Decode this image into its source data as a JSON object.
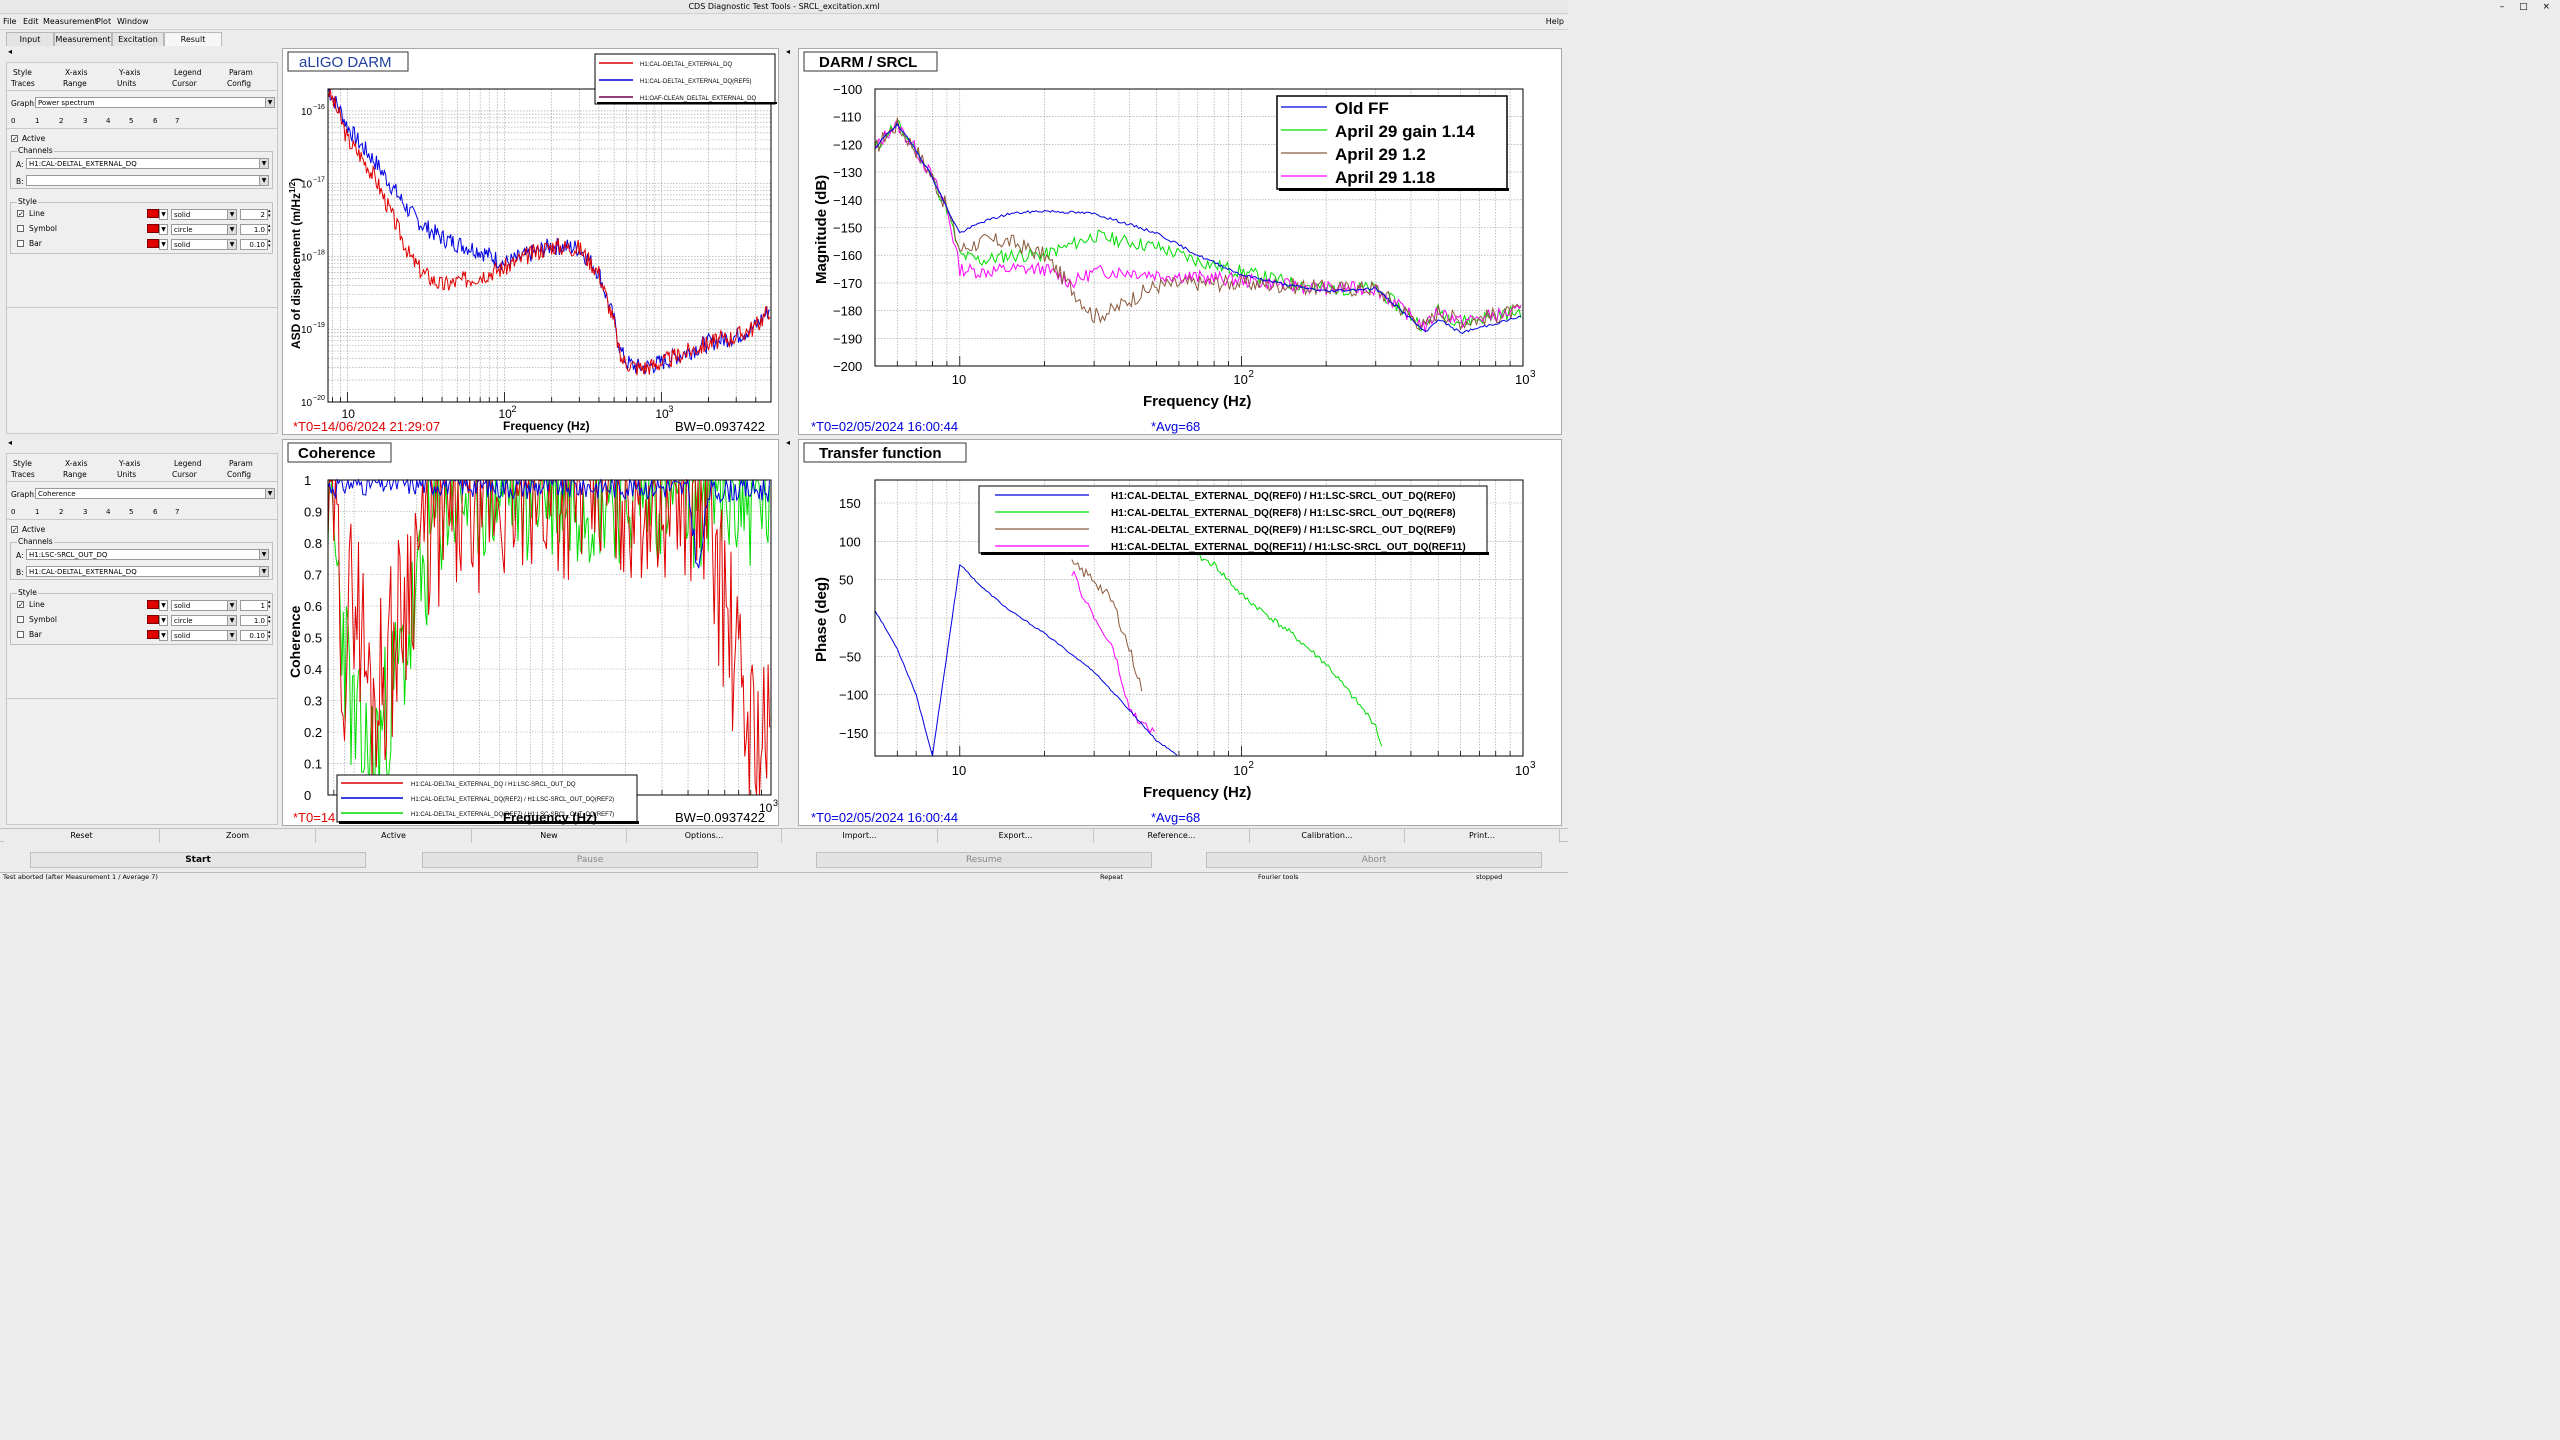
{
  "window": {
    "title": "CDS Diagnostic Test Tools - SRCL_excitation.xml",
    "controls": "– □ ×"
  },
  "menu": {
    "items": [
      "File",
      "Edit",
      "Measurement",
      "Plot",
      "Window"
    ],
    "help": "Help"
  },
  "tabs": [
    "Input",
    "Measurement",
    "Excitation",
    "Result"
  ],
  "collapse_glyph": "◂",
  "options_top": {
    "tabs_row1": [
      "Style",
      "X-axis",
      "Y-axis",
      "Legend",
      "Param"
    ],
    "tabs_row2": [
      "Traces",
      "Range",
      "Units",
      "Cursor",
      "Config"
    ],
    "graph_label": "Graph:",
    "graph_value": "Power spectrum",
    "trace_numbers": [
      "0",
      "1",
      "2",
      "3",
      "4",
      "5",
      "6",
      "7"
    ],
    "active_label": "Active",
    "channels_label": "Channels",
    "chan_a_label": "A:",
    "chan_a": "H1:CAL-DELTAL_EXTERNAL_DQ",
    "chan_b_label": "B:",
    "chan_b": "",
    "style_label": "Style",
    "line_label": "Line",
    "symbol_label": "Symbol",
    "bar_label": "Bar",
    "line_style": "solid",
    "symbol_style": "circle",
    "bar_style": "solid",
    "line_width": "2",
    "symbol_size": "1.0",
    "bar_width": "0.10"
  },
  "options_bottom": {
    "tabs_row1": [
      "Style",
      "X-axis",
      "Y-axis",
      "Legend",
      "Param"
    ],
    "tabs_row2": [
      "Traces",
      "Range",
      "Units",
      "Cursor",
      "Config"
    ],
    "graph_label": "Graph:",
    "graph_value": "Coherence",
    "trace_numbers": [
      "0",
      "1",
      "2",
      "3",
      "4",
      "5",
      "6",
      "7"
    ],
    "active_label": "Active",
    "channels_label": "Channels",
    "chan_a_label": "A:",
    "chan_a": "H1:LSC-SRCL_OUT_DQ",
    "chan_b_label": "B:",
    "chan_b": "H1:CAL-DELTAL_EXTERNAL_DQ",
    "style_label": "Style",
    "line_label": "Line",
    "symbol_label": "Symbol",
    "bar_label": "Bar",
    "line_style": "solid",
    "symbol_style": "circle",
    "bar_style": "solid",
    "line_width": "1",
    "symbol_size": "1.0",
    "bar_width": "0.10"
  },
  "plots": {
    "darm": {
      "title": "aLIGO DARM",
      "t0": "*T0=14/06/2024 21:29:07",
      "bw": "BW=0.0937422",
      "xlabel": "Frequency (Hz)",
      "ylabel": "ASD of displacement (m/Hz",
      "ylabel_sup": "1/2",
      "ylabel_end": ")",
      "legend": [
        "H1:CAL-DELTAL_EXTERNAL_DQ",
        "H1:CAL-DELTAL_EXTERNAL_DQ(REF5)",
        "H1:OAF-CLEAN_DELTAL_EXTERNAL_DQ"
      ],
      "xtick_labels": [
        "10",
        "10",
        "10"
      ],
      "xtick_exps": [
        "",
        "2",
        "3"
      ],
      "ytick_base": "10",
      "ytick_exps": [
        "−16",
        "−17",
        "−18",
        "−19",
        "−20"
      ]
    },
    "srcl": {
      "title": "DARM / SRCL",
      "t0": "*T0=02/05/2024 16:00:44",
      "avg": "*Avg=68",
      "xlabel": "Frequency (Hz)",
      "ylabel": "Magnitude (dB)",
      "legend": [
        "Old FF",
        "April 29 gain 1.14",
        "April 29 1.2",
        "April 29 1.18"
      ],
      "ytick_labels": [
        "−100",
        "−110",
        "−120",
        "−130",
        "−140",
        "−150",
        "−160",
        "−170",
        "−180",
        "−190",
        "−200"
      ],
      "xtick_labels": [
        "10",
        "10",
        "10"
      ],
      "xtick_exps": [
        "",
        "2",
        "3"
      ]
    },
    "coh": {
      "title": "Coherence",
      "t0": "*T0=14",
      "bw": "BW=0.0937422",
      "xlabel": "Frequency (Hz)",
      "ylabel": "Coherence",
      "x_end_label": "10",
      "x_end_exp": "3",
      "legend": [
        "H1:CAL-DELTAL_EXTERNAL_DQ / H1:LSC-SRCL_OUT_DQ",
        "H1:CAL-DELTAL_EXTERNAL_DQ(REF2) / H1:LSC-SRCL_OUT_DQ(REF2)",
        "H1:CAL-DELTAL_EXTERNAL_DQ(REF7) / H1:LSC-SRCL_OUT_DQ(REF7)"
      ],
      "ytick_labels": [
        "1",
        "0.9",
        "0.8",
        "0.7",
        "0.6",
        "0.5",
        "0.4",
        "0.3",
        "0.2",
        "0.1",
        "0"
      ]
    },
    "tf": {
      "title": "Transfer function",
      "t0": "*T0=02/05/2024 16:00:44",
      "avg": "*Avg=68",
      "xlabel": "Frequency (Hz)",
      "ylabel": "Phase (deg)",
      "legend": [
        "H1:CAL-DELTAL_EXTERNAL_DQ(REF0) / H1:LSC-SRCL_OUT_DQ(REF0)",
        "H1:CAL-DELTAL_EXTERNAL_DQ(REF8) / H1:LSC-SRCL_OUT_DQ(REF8)",
        "H1:CAL-DELTAL_EXTERNAL_DQ(REF9) / H1:LSC-SRCL_OUT_DQ(REF9)",
        "H1:CAL-DELTAL_EXTERNAL_DQ(REF11) / H1:LSC-SRCL_OUT_DQ(REF11)"
      ],
      "ytick_labels": [
        "150",
        "100",
        "50",
        "0",
        "−50",
        "−100",
        "−150"
      ],
      "xtick_labels": [
        "10",
        "10",
        "10"
      ],
      "xtick_exps": [
        "",
        "2",
        "3"
      ]
    }
  },
  "colors": {
    "red": "#e00000",
    "blue": "#0000e0",
    "purple": "#700050",
    "green": "#00dd00",
    "brown": "#8b5a3c",
    "magenta": "#ff00ff",
    "title_blue": "#2040a0"
  },
  "buttons_row": [
    "Reset",
    "Zoom",
    "Active",
    "New",
    "Options...",
    "Import...",
    "Export...",
    "Reference...",
    "Calibration...",
    "Print..."
  ],
  "control_buttons": [
    "Start",
    "Pause",
    "Resume",
    "Abort"
  ],
  "status": {
    "message": "Test aborted (after Measurement 1 / Average 7)",
    "mode": "Repeat",
    "tools": "Fourier tools",
    "state": "stopped"
  },
  "chart_data": [
    {
      "type": "line",
      "title": "aLIGO DARM",
      "xlabel": "Frequency (Hz)",
      "ylabel": "ASD of displacement (m/Hz^1/2)",
      "xscale": "log",
      "yscale": "log",
      "xlim": [
        7.5,
        5000
      ],
      "ylim": [
        1e-20,
        2e-16
      ],
      "legend": "top-right",
      "grid": true,
      "series": [
        {
          "name": "H1:CAL-DELTAL_EXTERNAL_DQ",
          "color": "#e00000",
          "x": [
            7.5,
            9,
            10,
            12,
            15,
            20,
            25,
            30,
            40,
            50,
            70,
            100,
            150,
            200,
            300,
            400,
            500,
            550,
            600,
            700,
            800,
            1000,
            1500,
            2000,
            3000,
            4000,
            5000
          ],
          "y": [
            2e-16,
            8e-17,
            4e-17,
            2.5e-17,
            1.2e-17,
            3e-18,
            1e-18,
            6e-19,
            4e-19,
            4.5e-19,
            5.5e-19,
            7e-19,
            1.1e-18,
            1.4e-18,
            1.3e-18,
            6e-19,
            1.2e-19,
            4e-20,
            3.5e-20,
            3e-20,
            3e-20,
            3.5e-20,
            5e-20,
            6.5e-20,
            8e-20,
            1.1e-19,
            2e-19
          ]
        },
        {
          "name": "H1:CAL-DELTAL_EXTERNAL_DQ(REF5)",
          "color": "#0000e0",
          "x": [
            7.5,
            9,
            10,
            12,
            15,
            20,
            25,
            30,
            40,
            50,
            70,
            100,
            150,
            200,
            300,
            400,
            500,
            550,
            600,
            700,
            800,
            1000,
            1500,
            2000,
            3000,
            4000,
            5000
          ],
          "y": [
            2e-16,
            1e-16,
            6e-17,
            3.5e-17,
            2e-17,
            8e-18,
            4e-18,
            2.7e-18,
            1.8e-18,
            1.5e-18,
            1.2e-18,
            8e-19,
            1.1e-18,
            1.4e-18,
            1.3e-18,
            6e-19,
            1.3e-19,
            5e-20,
            3.5e-20,
            3e-20,
            3e-20,
            3.5e-20,
            5e-20,
            6.5e-20,
            8e-20,
            1.1e-19,
            2e-19
          ]
        },
        {
          "name": "H1:OAF-CLEAN_DELTAL_EXTERNAL_DQ",
          "color": "#700050",
          "x": [],
          "y": []
        }
      ]
    },
    {
      "type": "line",
      "title": "DARM / SRCL",
      "xlabel": "Frequency (Hz)",
      "ylabel": "Magnitude (dB)",
      "xscale": "log",
      "xlim": [
        5,
        1000
      ],
      "ylim": [
        -200,
        -100
      ],
      "legend": "top-right",
      "grid": true,
      "series": [
        {
          "name": "Old FF",
          "color": "#0000e0",
          "x": [
            5,
            5.5,
            6,
            7,
            8,
            9,
            10,
            12,
            15,
            20,
            30,
            50,
            70,
            100,
            150,
            200,
            300,
            400,
            450,
            500,
            600,
            1000
          ],
          "y": [
            -122,
            -116,
            -113,
            -122,
            -132,
            -143,
            -152,
            -148,
            -145,
            -144,
            -145,
            -152,
            -160,
            -167,
            -171,
            -173,
            -172,
            -183,
            -188,
            -183,
            -188,
            -182
          ]
        },
        {
          "name": "April 29 gain 1.14",
          "color": "#00dd00",
          "x": [
            5,
            5.5,
            6,
            7,
            8,
            9,
            10,
            12,
            15,
            20,
            30,
            50,
            70,
            100,
            150,
            200,
            300,
            400,
            450,
            500,
            600,
            1000
          ],
          "y": [
            -122,
            -116,
            -113,
            -122,
            -132,
            -143,
            -160,
            -162,
            -160,
            -160,
            -153,
            -157,
            -162,
            -166,
            -170,
            -172,
            -172,
            -182,
            -186,
            -180,
            -184,
            -180
          ]
        },
        {
          "name": "April 29 1.2",
          "color": "#8b5a3c",
          "x": [
            5,
            5.5,
            6,
            7,
            8,
            9,
            10,
            12,
            15,
            20,
            25,
            30,
            35,
            40,
            50,
            70,
            100,
            150,
            200,
            300,
            400,
            450,
            500,
            600,
            1000
          ],
          "y": [
            -122,
            -116,
            -113,
            -122,
            -132,
            -143,
            -158,
            -155,
            -155,
            -160,
            -172,
            -182,
            -180,
            -176,
            -171,
            -170,
            -170,
            -171,
            -172,
            -172,
            -182,
            -186,
            -180,
            -184,
            -180
          ]
        },
        {
          "name": "April 29 1.18",
          "color": "#ff00ff",
          "x": [
            5,
            5.5,
            6,
            7,
            8,
            9,
            10,
            12,
            15,
            20,
            25,
            30,
            40,
            50,
            70,
            100,
            150,
            200,
            300,
            400,
            450,
            500,
            600,
            1000
          ],
          "y": [
            -122,
            -116,
            -113,
            -122,
            -132,
            -143,
            -165,
            -166,
            -165,
            -165,
            -170,
            -166,
            -166,
            -167,
            -168,
            -169,
            -171,
            -172,
            -172,
            -182,
            -186,
            -180,
            -184,
            -180
          ]
        }
      ]
    },
    {
      "type": "line",
      "title": "Coherence",
      "xlabel": "Frequency (Hz)",
      "ylabel": "Coherence",
      "xscale": "log",
      "xlim": [
        7.5,
        1000
      ],
      "ylim": [
        0,
        1
      ],
      "legend": "bottom",
      "grid": true,
      "series": [
        {
          "name": "H1:CAL-DELTAL_EXTERNAL_DQ / H1:LSC-SRCL_OUT_DQ",
          "color": "#e00000",
          "x": [
            7.5,
            8,
            9,
            10,
            12,
            15,
            20,
            30,
            50,
            70,
            100,
            150,
            200,
            300,
            400,
            500,
            600,
            700,
            800,
            1000
          ],
          "y": [
            0.9,
            0.95,
            0.4,
            0.7,
            0.3,
            0.45,
            0.8,
            0.9,
            0.96,
            0.97,
            0.98,
            0.98,
            0.98,
            0.98,
            0.97,
            0.9,
            0.6,
            0.35,
            0.2,
            0.15
          ]
        },
        {
          "name": "H1:CAL-DELTAL_EXTERNAL_DQ(REF2) / H1:LSC-SRCL_OUT_DQ(REF2)",
          "color": "#0000e0",
          "x": [
            7.5,
            10,
            15,
            20,
            30,
            50,
            70,
            100,
            150,
            200,
            300,
            400,
            450,
            500,
            600,
            1000
          ],
          "y": [
            0.98,
            0.99,
            0.99,
            0.99,
            0.99,
            0.98,
            0.98,
            0.98,
            0.98,
            0.98,
            0.98,
            0.97,
            0.7,
            0.96,
            0.97,
            0.97
          ]
        },
        {
          "name": "H1:CAL-DELTAL_EXTERNAL_DQ(REF7) / H1:LSC-SRCL_OUT_DQ(REF7)",
          "color": "#00dd00",
          "x": [
            7.5,
            10,
            12,
            15,
            20,
            25,
            30,
            40,
            50,
            70,
            100,
            200,
            300,
            400,
            500,
            1000
          ],
          "y": [
            0.98,
            0.2,
            0.1,
            0.3,
            0.6,
            0.9,
            0.95,
            0.97,
            0.98,
            0.98,
            0.98,
            0.98,
            0.98,
            0.97,
            0.96,
            0.95
          ]
        }
      ]
    },
    {
      "type": "line",
      "title": "Transfer function",
      "xlabel": "Frequency (Hz)",
      "ylabel": "Phase (deg)",
      "xscale": "log",
      "xlim": [
        5,
        1000
      ],
      "ylim": [
        -180,
        180
      ],
      "legend": "top-right",
      "grid": true,
      "series": [
        {
          "name": "H1:CAL-DELTAL_EXTERNAL_DQ(REF0) / H1:LSC-SRCL_OUT_DQ(REF0)",
          "color": "#0000e0",
          "x": [
            5,
            6,
            7,
            8,
            10,
            12,
            15,
            20,
            30,
            40,
            50,
            60
          ],
          "y": [
            10,
            -40,
            -100,
            -180,
            70,
            40,
            10,
            -20,
            -70,
            -120,
            -160,
            -180
          ]
        },
        {
          "name": "H1:CAL-DELTAL_EXTERNAL_DQ(REF8) / H1:LSC-SRCL_OUT_DQ(REF8)",
          "color": "#00dd00",
          "x": [
            70,
            80,
            100,
            150,
            200,
            300,
            320
          ],
          "y": [
            80,
            70,
            30,
            -20,
            -60,
            -140,
            -180
          ]
        },
        {
          "name": "H1:CAL-DELTAL_EXTERNAL_DQ(REF9) / H1:LSC-SRCL_OUT_DQ(REF9)",
          "color": "#8b5a3c",
          "x": [
            25,
            30,
            35,
            40,
            45
          ],
          "y": [
            70,
            50,
            20,
            -40,
            -100
          ]
        },
        {
          "name": "H1:CAL-DELTAL_EXTERNAL_DQ(REF11) / H1:LSC-SRCL_OUT_DQ(REF11)",
          "color": "#ff00ff",
          "x": [
            25,
            30,
            35,
            40,
            45,
            50
          ],
          "y": [
            60,
            0,
            -40,
            -120,
            -140,
            -150
          ]
        }
      ]
    }
  ]
}
